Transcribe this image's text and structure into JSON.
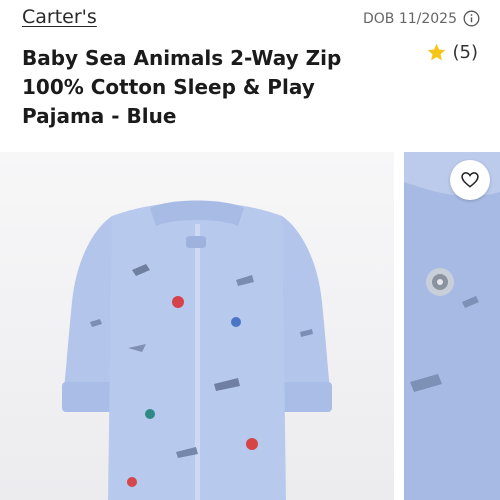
{
  "header": {
    "brand": "Carter's",
    "dob_label": "DOB 11/2025",
    "info_icon": "info-circle-icon"
  },
  "product": {
    "title": "Baby Sea Animals 2-Way Zip 100% Cotton Sleep & Play Pajama - Blue",
    "rating_icon": "star-icon",
    "rating_count": "(5)",
    "star_color": "#f5c518"
  },
  "gallery": {
    "main_image": "blue-sea-animals-pajama-photo",
    "side_image": "pajama-snap-detail-photo",
    "favorite_icon": "heart-outline-icon",
    "fabric_color": "#b4c6ec"
  }
}
